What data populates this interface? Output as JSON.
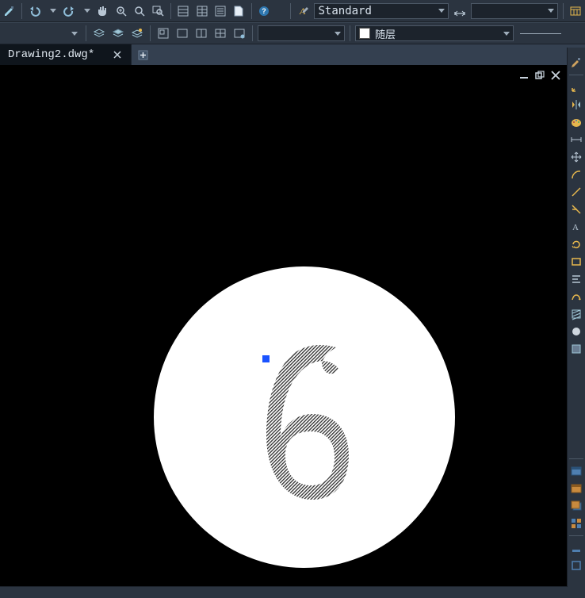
{
  "tab": {
    "title": "Drawing2.dwg*"
  },
  "textStyle": {
    "current": "Standard"
  },
  "lineType": {
    "current": "随层"
  },
  "drawing": {
    "numeral": "6"
  },
  "right_tools": {
    "section_a": [
      "paint-brush-icon",
      "wcs-icon",
      "mirror-icon",
      "palette-icon",
      "dim-icon",
      "move-icon",
      "arc-icon",
      "line-icon",
      "trim-tool-icon",
      "annotate-icon",
      "rotate-cw-icon",
      "rect-icon",
      "align-icon",
      "path-icon",
      "hatch-icon",
      "circle-fill-icon",
      "block-icon"
    ],
    "section_b": [
      "window1-icon",
      "window2-icon",
      "window3-icon",
      "tile-icon"
    ],
    "section_c": [
      "minimize-all-icon",
      "restore-all-icon"
    ]
  }
}
